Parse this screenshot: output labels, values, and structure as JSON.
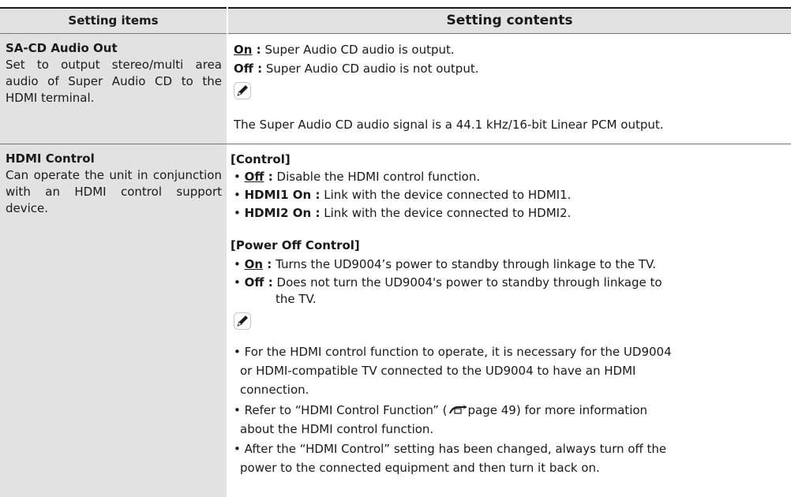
{
  "header": {
    "col1": "Setting items",
    "col2": "Setting contents"
  },
  "rows": [
    {
      "title": "SA-CD Audio Out",
      "desc": "Set to output stereo/multi area audio of Super Audio CD to the HDMI terminal.",
      "options": [
        {
          "key": "On",
          "sep": " :",
          "text": " Super Audio CD audio is output."
        },
        {
          "key": "Off",
          "sep": " :",
          "text": " Super Audio CD audio is not output."
        }
      ],
      "note": "The Super Audio CD audio signal is a 44.1 kHz/16-bit Linear PCM output."
    },
    {
      "title": "HDMI Control",
      "desc": "Can operate the unit in conjunction with an HDMI control support device.",
      "control": {
        "heading": "[Control]",
        "items": [
          {
            "key": "Off",
            "sep": " :",
            "text": " Disable the HDMI control function."
          },
          {
            "key": "HDMI1 On",
            "sep": " :",
            "text": " Link with the device connected to HDMI1."
          },
          {
            "key": "HDMI2 On",
            "sep": " :",
            "text": " Link with the device connected to HDMI2."
          }
        ]
      },
      "power_off": {
        "heading": "[Power Off Control]",
        "items": [
          {
            "key": "On",
            "sep": " :",
            "text": " Turns the UD9004’s power to standby through linkage to the TV."
          },
          {
            "key": "Off",
            "sep": " :",
            "text": " Does not turn the UD9004's power to standby through linkage to",
            "cont": "the TV."
          }
        ]
      },
      "notes": [
        {
          "lines": [
            "For the HDMI control function to operate, it is necessary for the UD9004",
            "or HDMI-compatible TV connected to the UD9004  to have an HDMI",
            "connection."
          ]
        },
        {
          "lines_pre": "Refer to “HDMI Control Function” (",
          "ref_icon": "page-ref-icon",
          "lines_post": "page 49) for more information",
          "line2": "about the HDMI control function."
        },
        {
          "lines": [
            "After the “HDMI Control” setting has been changed, always turn off the",
            "power to the connected equipment and then turn it back on."
          ]
        }
      ]
    }
  ],
  "icons": {
    "note": "pencil-icon",
    "ref": "page-ref-icon"
  }
}
